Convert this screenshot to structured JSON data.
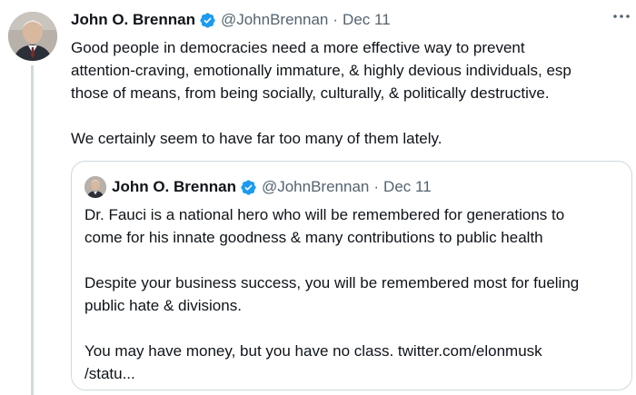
{
  "tweet": {
    "author_name": "John O. Brennan",
    "handle": "@JohnBrennan",
    "separator": "·",
    "date": "Dec 11",
    "avatar_icon": "person-photo-avatar",
    "verified_icon": "verified-badge-icon",
    "text": "Good people in democracies need a more effective way to prevent\nattention-craving, emotionally immature, & highly devious individuals, esp\nthose of means, from being socially, culturally, & politically destructive.\n\nWe certainly seem to have far too many of them lately."
  },
  "quote": {
    "author_name": "John O. Brennan",
    "handle": "@JohnBrennan",
    "separator": "·",
    "date": "Dec 11",
    "avatar_icon": "person-photo-avatar",
    "verified_icon": "verified-badge-icon",
    "text": "Dr. Fauci is a national hero who will be remembered for generations to\ncome for his innate goodness & many contributions to public health\n\nDespite your business success, you will be remembered most for fueling\npublic hate & divisions.\n\nYou may have money, but you have no class. twitter.com/elonmusk\n/statu..."
  },
  "colors": {
    "text": "#0f1419",
    "secondary": "#536471",
    "verified": "#1d9bf0",
    "border": "#cfd9de"
  }
}
